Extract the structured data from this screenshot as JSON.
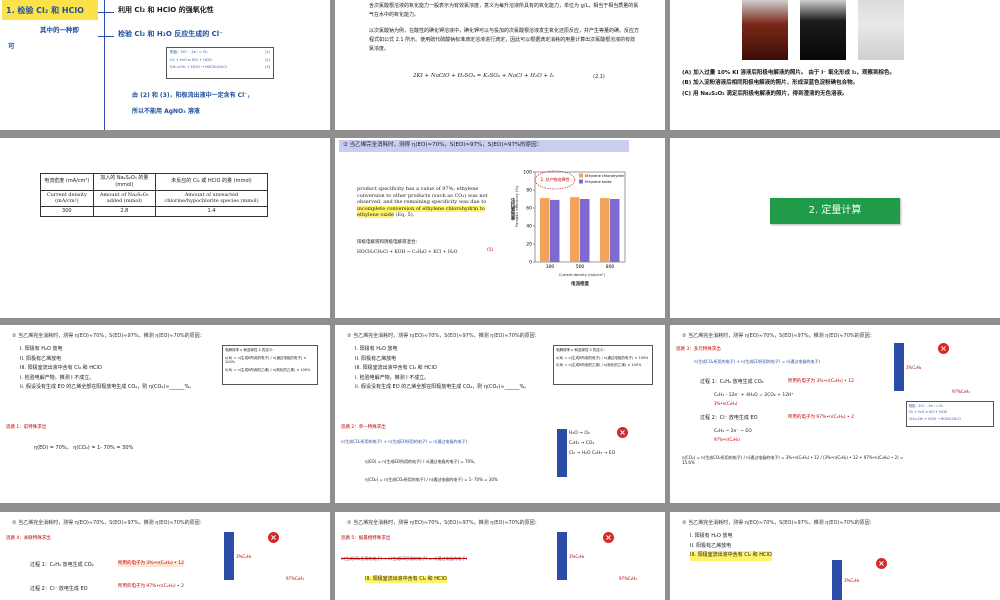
{
  "slide1": {
    "heading_line1": "1. 检验 Cl₂ 和 HClO",
    "heading_line2": "其中的一种即",
    "heading_line3": "可",
    "right_title": "利用 Cl₂ 和 HClO 的强氧化性",
    "right_sub": "检验 Cl₂ 和 H₂O 反应生成的 Cl⁻",
    "eq_box": [
      "阳极：2Cl⁻ - 2e⁻ = Cl₂",
      "Cl₂ + H₂O ⇌ HCl + HClO",
      "CH₂=CH₂ + HClO → HOCH₂CH₂Cl"
    ],
    "eq_nums": [
      "(1)",
      "(2)",
      "(3)"
    ],
    "conclusion_1": "由 (2) 和 (3)，阳极流出液中一定含有 Cl⁻，",
    "conclusion_2": "所以不能用 AgNO₃ 溶液"
  },
  "slide2": {
    "para1": "含次氯酸根溶液的氧化能力一般表示为有效氯浓度，意义为每升溶液所具有的氧化能力，单位为 g/L，相当于相当质量的氯气在水中的氧化能力。",
    "para2": "以次氯酸钠为例，在酸性的碘化钾溶液中，碘化钾可以与投加的次氯酸根溶液发生氧化还原反应，并产生等量的碘。反应方程式如公式 2.1 所示。使用硫代硫酸钠标准滴定溶液进行滴定，因此可以根据滴定消耗的用量计算出次氯酸根溶液的有效氯浓度。",
    "equation": "2KI + NaClO + H₂SO₄ = K₂SO₄ + NaCl + H₂O + I₂",
    "eq_num": "(2.1)"
  },
  "slide3": {
    "captions": [
      "(A) 加入过量 10% KI 溶液后阳极电解液的照片。 由于 I⁻ 氧化形成 I₂，观察到棕色。",
      "(B) 加入淀粉溶液后相同阳极电解液的照片，形成深蓝色淀粉碘包合物。",
      "(C) 用 Na₂S₂O₃ 滴定后阳极电解液的照片，得到澄清的无色溶液。"
    ]
  },
  "slide4": {
    "table_headers_cn": [
      "电流密度 (mA/cm²)",
      "加入的 Na₂S₂O₃ 的量 (mmol)",
      "未反应的 Cl₂ 或 HClO 的量 (mmol)"
    ],
    "table_headers_en": [
      "Current density (mA/cm²)",
      "Amount of Na₂S₂O₃ added (mmol)",
      "Amount of unreacted chlorine/hypochlorite species (mmol)"
    ],
    "table_row": [
      "300",
      "2.8",
      "1.4"
    ]
  },
  "slide5": {
    "banner": "② 当乙烯完全消耗时，测得 η(EO)≈70%，S(EO)≈97%，S(EO)≈97%的原因：",
    "text_1": "product specificity has a value of 97%; ethylene conversion to other products (such as CO₂) was not observed, and the remaining specificity was due to ",
    "text_hl": "incomplete conversion of ethylene chlorohydrin to ethylene oxide",
    "text_2": " (Eq. 5).",
    "cn_note": "阳极电解液和阴极电解液混合：",
    "reaction": "HOCH₂CH₂Cl + KOH → C₂H₄O + KCl + H₂O",
    "reaction_num": "(5)",
    "ylabel": "法拉第效率",
    "ylabel_en": "Faradaic efficiency (%)",
    "xlabel": "电流密度",
    "xlabel_en": "Current density (mA/cm²)",
    "legend_tag": "2. 总产物选择性",
    "colors": {
      "chlorohydrin": "#f4a259",
      "oxide": "#7f6bd0"
    }
  },
  "chart_data": {
    "type": "bar",
    "categories": [
      "300",
      "500",
      "800"
    ],
    "series": [
      {
        "name": "Ethylene chlorohydrin",
        "values": [
          71,
          72,
          71
        ]
      },
      {
        "name": "Ethylene oxide",
        "values": [
          69,
          70,
          70
        ]
      }
    ],
    "ylim": [
      0,
      100
    ],
    "yticks": [
      "0",
      "20",
      "40",
      "60",
      "80",
      "100"
    ],
    "ylabel": "Faradaic efficiency (%)",
    "xlabel": "Current density (mA/cm²)"
  },
  "slide6": {
    "button": "2. 定量计算"
  },
  "common": {
    "question": "② 当乙烯完全消耗时，测得 η(EO)≈70%，S(EO)≈97%，推测 η(EO)≈70%的原因：",
    "reasons": [
      "I. 阳极有 H₂O 放电",
      "II. 阳极有乙烯放电",
      "III. 阳极室流出液中含有 Cl₂ 和 HClO"
    ],
    "steps": [
      "i. 检验电解产物，推测 I 不成立。",
      "ii. 假设没有生成 EO 的乙烯全部在阳极放电生成 CO₂，则 η(CO₂)≈______%。"
    ],
    "def_title": "电解效率 η 和选择性 S 的定义：",
    "def_eta": "η(B) = n(生成B所用的电子) / n(通过电极的电子) × 100%",
    "def_s": "S(B) = n(生成B所用的乙烯) / n(转化的乙烯) × 100%"
  },
  "slide7": {
    "tip": "思路 1：前特殊求出",
    "calc": "η(EO) = 70%，   η(CO₂) = 1- 70% = 30%"
  },
  "slide8": {
    "tip": "思路 2：单一特殊求出",
    "eq": "n(生成CO₂所用的电子) + n(生成EO所用的电子) = n(通过电极的电子)",
    "calc1": "η(EO) = n(生成EO所用的电子) / n(通过电极的电子) = 70%,",
    "calc2": "η(CO₂) = n(生成CO₂所用的电子) / n(通过电极的电子) = 1- 70% = 30%",
    "diagram": [
      "H₂O",
      "O₂",
      "C₂H₄",
      "CO₂",
      "Cl₂",
      "H₂O",
      "C₂H₄",
      "EO"
    ]
  },
  "slide9": {
    "tip": "思路 3：多元特殊求出",
    "eq": "n(生成CO₂所用的电子) + n(生成EO所用的电子) = n(通过电极的电子)",
    "proc1": "过程 1：C₂H₄ 放电生成 CO₂",
    "proc1_val": "所用的电子为 3%•n(C₂H₄) • 12",
    "proc1_eq1": "C₂H₄ - 12e⁻ + 4H₂O = 2CO₂ + 12H⁺",
    "proc1_eq2": "3%•n(C₂H₄)",
    "proc2": "过程 2：Cl⁻ 放电生成 EO",
    "proc2_val": "所用的电子为 97%•n(C₂H₄) • 2",
    "proc2_eq1": "C₂H₄ ~ 2e⁻ ~ EO",
    "proc2_eq2": "97%•n(C₂H₄)",
    "result": "η(CO₂) = n(生成CO₂所用的电子) / n(通过电极的电子) = 3%•n(C₂H₄) • 12 / (3%•n(C₂H₄) • 12 + 97%•n(C₂H₄) • 2) = 15.6%",
    "tags": [
      "3%C₂H₄",
      "97%C₂H₄"
    ]
  },
  "slide10": {
    "tip": "思路 4：关联特殊求出",
    "proc1": "过程 1：C₂H₄ 放电生成 CO₂",
    "proc1_val": "所用的电子为 3%•n(C₂H₄) • 12",
    "proc2": "过程 2：Cl⁻ 放电生成 EO",
    "proc2_val": "所用的电子为 97%•n(C₂H₄) • 2"
  },
  "slide11": {
    "tip": "思路 5：据最相特殊求出",
    "eq": "n(生成CO₂所用的电子) + n(生成EO所用的电子) = n(通过电极的电子)",
    "reason3": "III. 阳极室流出液中含有 Cl₂ 和 HClO"
  },
  "slide12": {
    "reasons": [
      "I. 阳极有 H₂O 放电",
      "II. 阳极有乙烯放电",
      "III. 阳极室流出液中含有 Cl₂ 和 HClO"
    ]
  }
}
